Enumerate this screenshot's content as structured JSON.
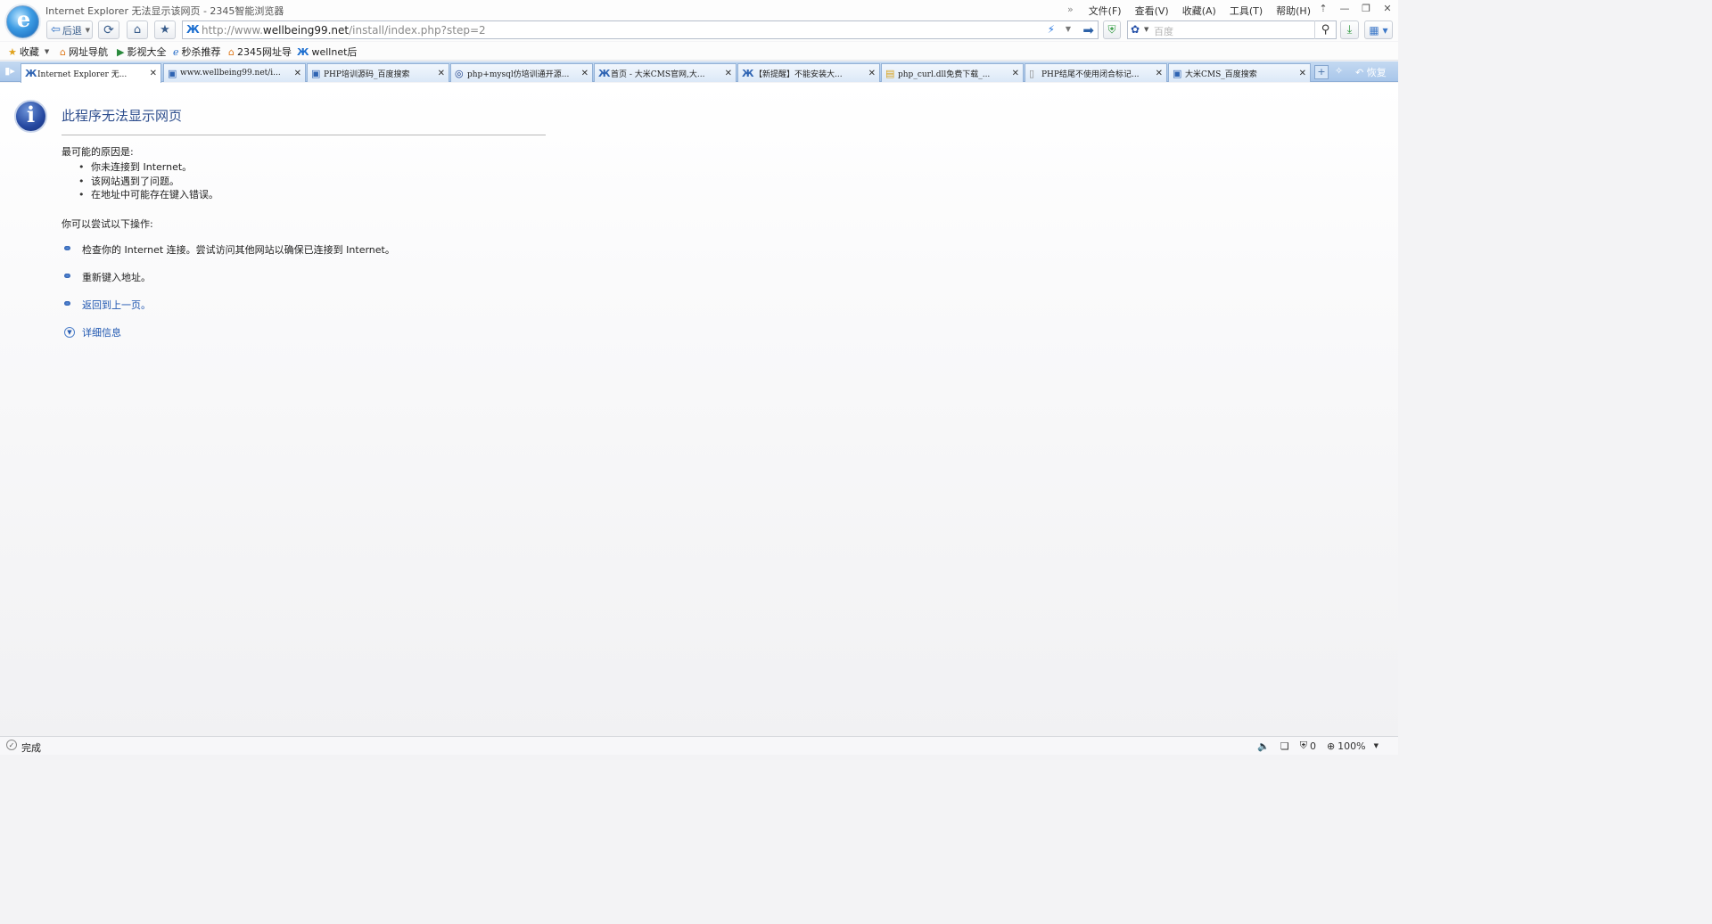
{
  "window": {
    "title": "Internet Explorer 无法显示该网页 - 2345智能浏览器",
    "menu": [
      "文件(F)",
      "查看(V)",
      "收藏(A)",
      "工具(T)",
      "帮助(H)"
    ]
  },
  "toolbar": {
    "back_label": "后退",
    "url_prefix": "http://www.",
    "url_domain": "wellbeing99.net",
    "url_path": "/install/index.php?step=2",
    "search_placeholder": "百度"
  },
  "favorites": [
    {
      "label": "收藏",
      "icon": "star-icon"
    },
    {
      "label": "网址导航",
      "icon": "house-icon"
    },
    {
      "label": "影视大全",
      "icon": "play-icon"
    },
    {
      "label": "秒杀推荐",
      "icon": "ie-icon"
    },
    {
      "label": "2345网址导",
      "icon": "house-icon"
    },
    {
      "label": "wellnet后",
      "icon": "site-icon"
    }
  ],
  "tabs": [
    {
      "label": "Internet Explorer 无...",
      "icon": "site-icon",
      "active": true
    },
    {
      "label": "www.wellbeing99.net/i...",
      "icon": "paw-icon",
      "active": false
    },
    {
      "label": "PHP培训源码_百度搜索",
      "icon": "paw-icon",
      "active": false
    },
    {
      "label": "php+mysql仿培训通开源...",
      "icon": "ring-icon",
      "active": false
    },
    {
      "label": "首页 - 大米CMS官网,大...",
      "icon": "site-icon",
      "active": false
    },
    {
      "label": "【新提醒】不能安装大...",
      "icon": "site-icon",
      "active": false
    },
    {
      "label": "php_curl.dll免费下载_...",
      "icon": "folder-icon",
      "active": false
    },
    {
      "label": "PHP结尾不使用闭合标记...",
      "icon": "page-icon",
      "active": false
    },
    {
      "label": "大米CMS_百度搜索",
      "icon": "paw-icon",
      "active": false
    }
  ],
  "tabbar": {
    "restore_label": "恢复"
  },
  "error": {
    "title": "此程序无法显示网页",
    "reasons_heading": "最可能的原因是:",
    "reasons": [
      "你未连接到 Internet。",
      "该网站遇到了问题。",
      "在地址中可能存在键入错误。"
    ],
    "try_heading": "你可以尝试以下操作:",
    "actions": [
      {
        "text": "检查你的 Internet 连接。尝试访问其他网站以确保已连接到 Internet。",
        "link": false
      },
      {
        "text": "重新键入地址。",
        "link": false
      },
      {
        "text": "返回到上一页。",
        "link": true
      }
    ],
    "details_label": "详细信息"
  },
  "status": {
    "text": "完成",
    "blocked_count": "0",
    "zoom": "100%"
  }
}
